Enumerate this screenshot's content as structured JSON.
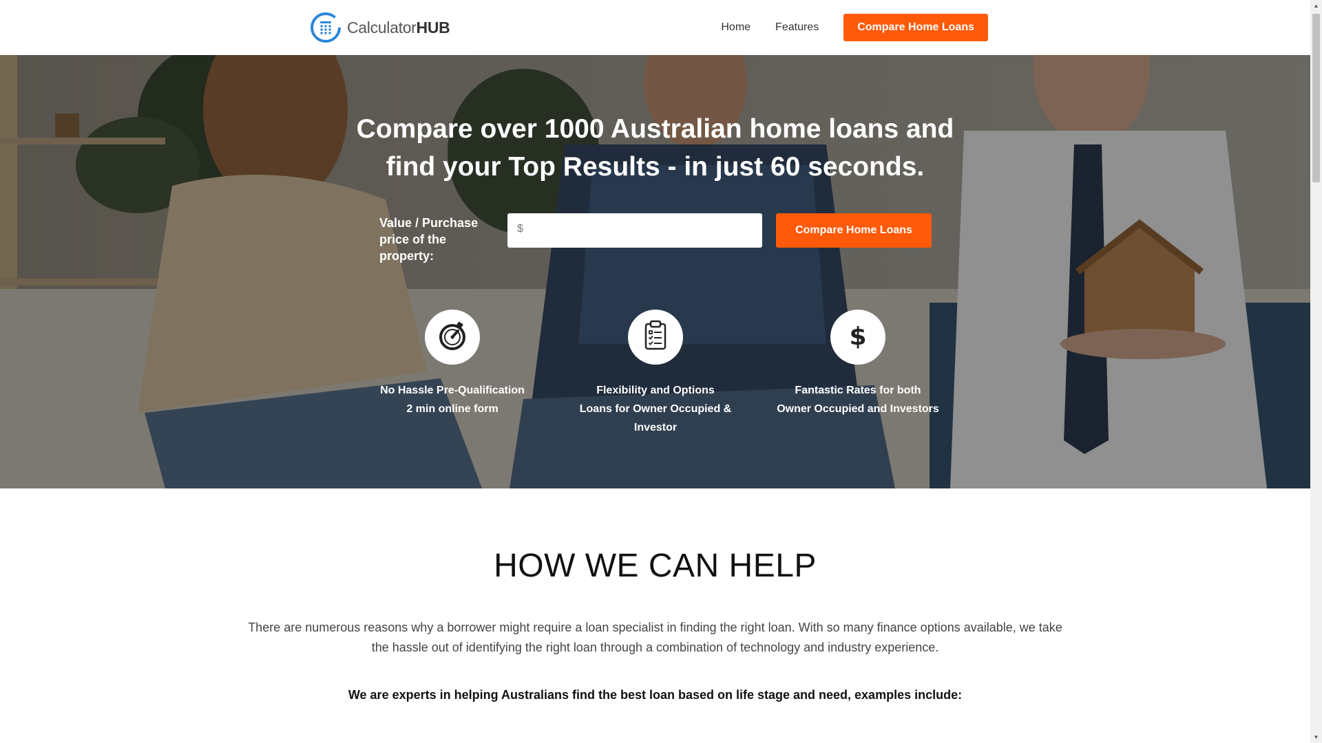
{
  "header": {
    "logo_text": "Calculator",
    "logo_text_bold": "HUB",
    "nav": [
      {
        "label": "Home"
      },
      {
        "label": "Features"
      }
    ],
    "cta_label": "Compare Home Loans"
  },
  "hero": {
    "title_line1": "Compare over 1000 Australian home loans and",
    "title_line2": "find your Top Results - in just 60 seconds.",
    "form": {
      "label_line1": "Value / Purchase",
      "label_line2": "price of the property:",
      "input_prefix": "$",
      "input_value": "",
      "cta_label": "Compare Home Loans"
    },
    "features": [
      {
        "icon": "stopwatch-icon",
        "lines": [
          "No Hassle Pre-Qualification",
          "2 min online form"
        ]
      },
      {
        "icon": "clipboard-checklist-icon",
        "lines": [
          "Flexibility and Options",
          "Loans for Owner Occupied &",
          "Investor"
        ]
      },
      {
        "icon": "dollar-icon",
        "lines": [
          "Fantastic Rates for both",
          "Owner Occupied and Investors"
        ]
      }
    ]
  },
  "help": {
    "title": "HOW WE CAN HELP",
    "body": "There are numerous reasons why a borrower might require a loan specialist in finding the right loan. With so many finance options available, we take the hassle out of identifying the right loan through a combination of technology and industry experience.",
    "subheading": "We are experts in helping Australians find the best loan based on life stage and need, examples include:"
  },
  "colors": {
    "accent": "#ff5a0a",
    "logo_blue": "#2b86d9"
  }
}
